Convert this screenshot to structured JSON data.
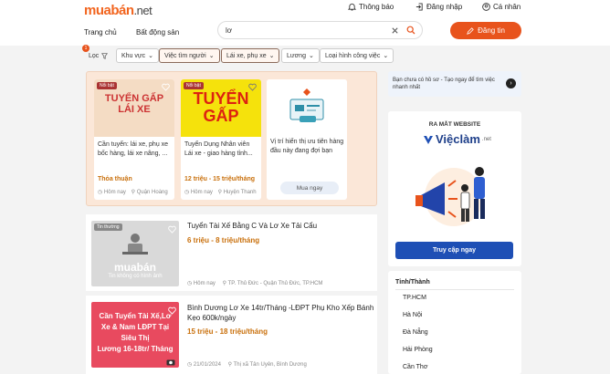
{
  "header": {
    "logo_main": "muabán",
    "logo_suffix": ".net",
    "notifications": "Thông báo",
    "post_label": "Đăng nhập",
    "account": "Cá nhân",
    "nav": [
      "Trang chủ",
      "Bất động sản"
    ],
    "search_value": "lơ",
    "post_button": "Đăng tin"
  },
  "filters": {
    "count": "1",
    "items": [
      "Lọc",
      "Khu vực",
      "Việc tìm người",
      "Lái xe, phụ xe",
      "Lương",
      "Loại hình công việc"
    ]
  },
  "promo_cards": [
    {
      "tag": "Nổi bật",
      "img_text": [
        "TUYỂN GẤP",
        "LÁI XE"
      ],
      "title": "Cần tuyển: lái xe, phụ xe bốc hàng, lái xe nâng, ...",
      "price": "Thỏa thuận",
      "time": "Hôm nay",
      "location": "Quận Hoàng"
    },
    {
      "tag": "Nổi bật",
      "img_text": [
        "TUYỂN",
        "GẤP"
      ],
      "title": "Tuyển Dụng Nhân viên Lái xe - giao hàng tỉnh...",
      "price": "12 triệu - 15 triệu/tháng",
      "time": "Hôm nay",
      "location": "Huyện Thanh"
    },
    {
      "title": "Vị trí hiển thị ưu tiên hàng đầu này đang đợi bạn",
      "button": "Mua ngay"
    }
  ],
  "listings": [
    {
      "tag": "Tin thường",
      "thumb_text": [
        "muabán",
        "Tin không có hình ảnh"
      ],
      "title": "Tuyển Tài Xế Bằng C Và Lơ Xe Tải Cẩu",
      "price": "6 triệu - 8 triệu/tháng",
      "time": "Hôm nay",
      "location": "TP. Thủ Đức - Quận Thủ Đức, TP.HCM"
    },
    {
      "thumb_text": [
        "Cần Tuyển Tài Xế,Lơ",
        "Xe & Nam LĐPT Tại",
        "Siêu Thị",
        "Lương 16-18tr/ Tháng"
      ],
      "title_lines": [
        "Bình Dương Lơ Xe 14tr/Tháng -LĐPT Phụ Kho Xếp Bánh",
        "Kẹo 600k/ngày"
      ],
      "price": "15 triệu - 18 triệu/tháng",
      "time": "21/01/2024",
      "location": "Thị xã Tân Uyên, Bình Dương"
    }
  ],
  "right": {
    "cv_banner": "Bạn chưa có hồ sơ - Tạo ngay để tìm việc nhanh nhất",
    "launch_title": "RA MẮT WEBSITE",
    "brand": "Việclàm",
    "brand_suffix": ".net",
    "cta": "Truy cập ngay",
    "region_title": "Tỉnh/Thành",
    "regions": [
      "TP.HCM",
      "Hà Nội",
      "Đà Nẵng",
      "Hải Phòng",
      "Cần Thơ"
    ]
  }
}
